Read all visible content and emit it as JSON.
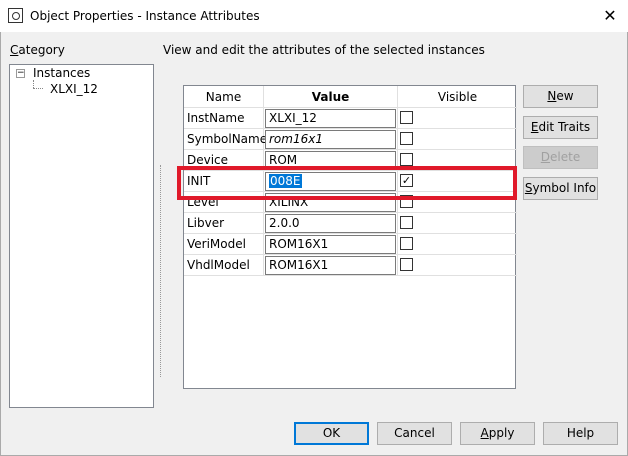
{
  "window": {
    "title": "Object Properties - Instance Attributes",
    "close_glyph": "✕"
  },
  "category": {
    "label": "Category",
    "tree": {
      "root": "Instances",
      "children": [
        "XLXI_12"
      ]
    }
  },
  "description": "View and edit the attributes of the selected instances",
  "grid": {
    "headers": {
      "name": "Name",
      "value": "Value",
      "visible": "Visible"
    },
    "rows": [
      {
        "name": "InstName",
        "value": "XLXI_12",
        "visible": false
      },
      {
        "name": "SymbolName",
        "value": "rom16x1",
        "visible": false
      },
      {
        "name": "Device",
        "value": "ROM",
        "visible": false
      },
      {
        "name": "INIT",
        "value": "008E",
        "visible": true
      },
      {
        "name": "Level",
        "value": "XILINX",
        "visible": false
      },
      {
        "name": "Libver",
        "value": "2.0.0",
        "visible": false
      },
      {
        "name": "VeriModel",
        "value": "ROM16X1",
        "visible": false
      },
      {
        "name": "VhdlModel",
        "value": "ROM16X1",
        "visible": false
      }
    ]
  },
  "side_buttons": {
    "new": "New",
    "edit_traits": "Edit Traits",
    "delete": "Delete",
    "symbol_info": "Symbol Info"
  },
  "bottom_buttons": {
    "ok": "OK",
    "cancel": "Cancel",
    "apply": "Apply",
    "help": "Help"
  },
  "colors": {
    "highlight_border": "#e0192a",
    "selection": "#0078d7"
  },
  "icons": {
    "window_icon": "properties-icon",
    "tree_expander": "minus-box-icon",
    "check": "checkmark-icon"
  }
}
